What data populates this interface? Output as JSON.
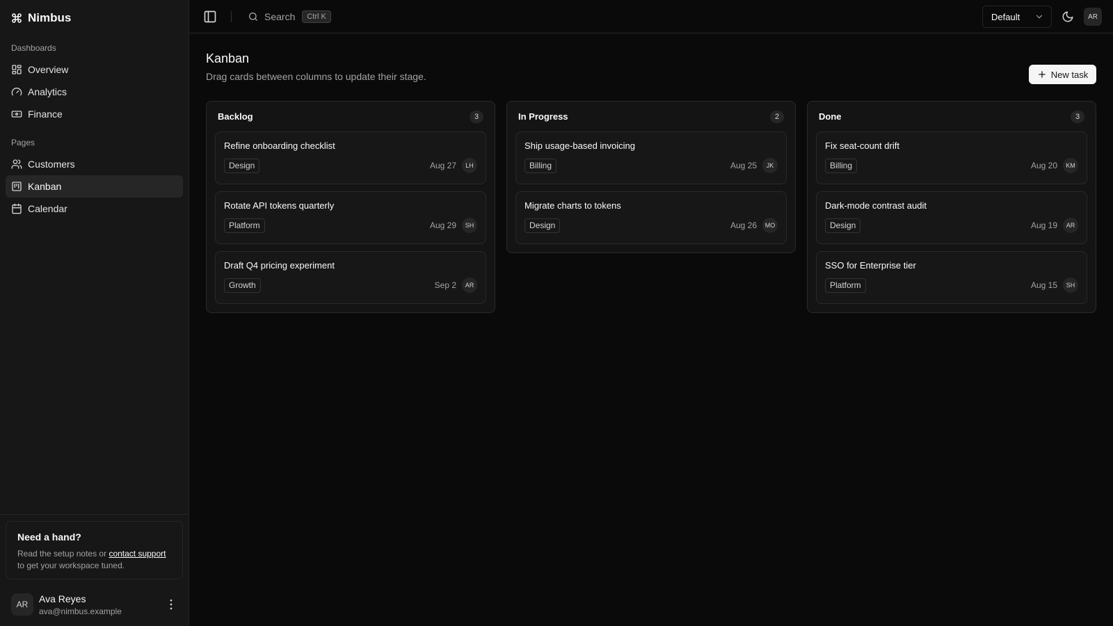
{
  "app": {
    "name": "Nimbus"
  },
  "sidebar": {
    "groups": [
      {
        "label": "Dashboards",
        "items": [
          {
            "label": "Overview",
            "icon": "grid-icon",
            "active": false
          },
          {
            "label": "Analytics",
            "icon": "gauge-icon",
            "active": false
          },
          {
            "label": "Finance",
            "icon": "banknote-icon",
            "active": false
          }
        ]
      },
      {
        "label": "Pages",
        "items": [
          {
            "label": "Customers",
            "icon": "users-icon",
            "active": false
          },
          {
            "label": "Kanban",
            "icon": "kanban-icon",
            "active": true
          },
          {
            "label": "Calendar",
            "icon": "calendar-icon",
            "active": false
          }
        ]
      }
    ],
    "help": {
      "title": "Need a hand?",
      "text_before": "Read the setup notes or",
      "link": "contact support",
      "text_after": "to get your workspace tuned."
    },
    "user": {
      "initials": "AR",
      "name": "Ava Reyes",
      "email": "ava@nimbus.example"
    }
  },
  "header": {
    "search_label": "Search",
    "search_shortcut": "Ctrl K",
    "theme_select": "Default",
    "avatar_initials": "AR"
  },
  "page": {
    "title": "Kanban",
    "subtitle": "Drag cards between columns to update their stage.",
    "new_task_label": "New task"
  },
  "board": {
    "columns": [
      {
        "title": "Backlog",
        "count": "3",
        "cards": [
          {
            "title": "Refine onboarding checklist",
            "tag": "Design",
            "due": "Aug 27",
            "assignee": "LH"
          },
          {
            "title": "Rotate API tokens quarterly",
            "tag": "Platform",
            "due": "Aug 29",
            "assignee": "SH"
          },
          {
            "title": "Draft Q4 pricing experiment",
            "tag": "Growth",
            "due": "Sep 2",
            "assignee": "AR"
          }
        ]
      },
      {
        "title": "In Progress",
        "count": "2",
        "cards": [
          {
            "title": "Ship usage-based invoicing",
            "tag": "Billing",
            "due": "Aug 25",
            "assignee": "JK"
          },
          {
            "title": "Migrate charts to tokens",
            "tag": "Design",
            "due": "Aug 26",
            "assignee": "MO"
          }
        ]
      },
      {
        "title": "Done",
        "count": "3",
        "cards": [
          {
            "title": "Fix seat-count drift",
            "tag": "Billing",
            "due": "Aug 20",
            "assignee": "KM"
          },
          {
            "title": "Dark-mode contrast audit",
            "tag": "Design",
            "due": "Aug 19",
            "assignee": "AR"
          },
          {
            "title": "SSO for Enterprise tier",
            "tag": "Platform",
            "due": "Aug 15",
            "assignee": "SH"
          }
        ]
      }
    ]
  }
}
